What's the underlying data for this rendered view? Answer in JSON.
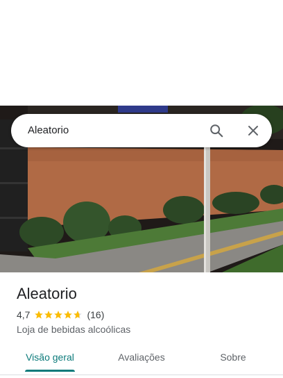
{
  "search": {
    "query": "Aleatorio"
  },
  "place": {
    "name": "Aleatorio",
    "rating": "4,7",
    "rating_value": 4.7,
    "review_count": "(16)",
    "category": "Loja de bebidas alcoólicas"
  },
  "tabs": [
    {
      "label": "Visão geral",
      "active": true
    },
    {
      "label": "Avaliações",
      "active": false
    },
    {
      "label": "Sobre",
      "active": false
    }
  ],
  "colors": {
    "accent": "#0b7a7a",
    "star": "#fbbc04"
  }
}
